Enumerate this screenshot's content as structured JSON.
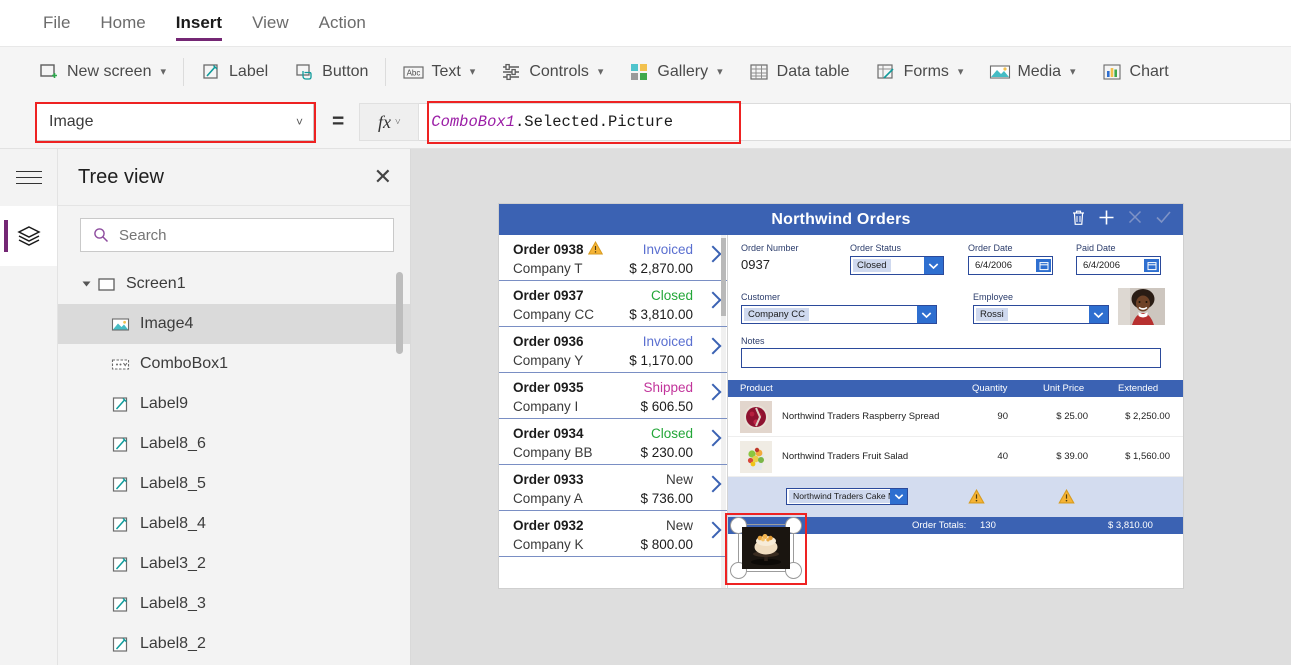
{
  "menu": {
    "items": [
      {
        "label": "File",
        "active": false
      },
      {
        "label": "Home",
        "active": false
      },
      {
        "label": "Insert",
        "active": true
      },
      {
        "label": "View",
        "active": false
      },
      {
        "label": "Action",
        "active": false
      }
    ]
  },
  "ribbon": {
    "items": [
      {
        "label": "New screen",
        "icon": "new-screen-icon",
        "chevron": true
      },
      {
        "label": "Label",
        "icon": "label-icon",
        "chevron": false
      },
      {
        "label": "Button",
        "icon": "button-icon",
        "chevron": false
      },
      {
        "label": "Text",
        "icon": "text-abc-icon",
        "chevron": true
      },
      {
        "label": "Controls",
        "icon": "controls-sliders-icon",
        "chevron": true
      },
      {
        "label": "Gallery",
        "icon": "gallery-icon",
        "chevron": true
      },
      {
        "label": "Data table",
        "icon": "data-table-icon",
        "chevron": false
      },
      {
        "label": "Forms",
        "icon": "forms-icon",
        "chevron": true
      },
      {
        "label": "Media",
        "icon": "media-image-icon",
        "chevron": true
      },
      {
        "label": "Chart",
        "icon": "chart-icon",
        "chevron": false
      }
    ]
  },
  "formula_bar": {
    "property": "Image",
    "equals": "=",
    "fx_label": "fx",
    "expression_ident": "ComboBox1",
    "expression_rest": ".Selected.Picture",
    "highlight_color": "#ee2222"
  },
  "tree_panel": {
    "title": "Tree view",
    "close_icon": "close-icon",
    "search_placeholder": "Search",
    "search_value": "",
    "nodes": [
      {
        "label": "Screen1",
        "icon": "screen-icon",
        "level": 0,
        "selected": false,
        "expanded": true
      },
      {
        "label": "Image4",
        "icon": "image-icon",
        "level": 1,
        "selected": true
      },
      {
        "label": "ComboBox1",
        "icon": "combobox-icon",
        "level": 1,
        "selected": false
      },
      {
        "label": "Label9",
        "icon": "label-icon",
        "level": 1,
        "selected": false
      },
      {
        "label": "Label8_6",
        "icon": "label-icon",
        "level": 1,
        "selected": false
      },
      {
        "label": "Label8_5",
        "icon": "label-icon",
        "level": 1,
        "selected": false
      },
      {
        "label": "Label8_4",
        "icon": "label-icon",
        "level": 1,
        "selected": false
      },
      {
        "label": "Label3_2",
        "icon": "label-icon",
        "level": 1,
        "selected": false
      },
      {
        "label": "Label8_3",
        "icon": "label-icon",
        "level": 1,
        "selected": false
      },
      {
        "label": "Label8_2",
        "icon": "label-icon",
        "level": 1,
        "selected": false
      }
    ]
  },
  "app": {
    "title": "Northwind Orders",
    "header_icons": [
      {
        "name": "delete-icon",
        "enabled": true
      },
      {
        "name": "add-icon",
        "enabled": true
      },
      {
        "name": "cancel-icon",
        "enabled": false
      },
      {
        "name": "save-icon",
        "enabled": false
      }
    ],
    "gallery": [
      {
        "order": "Order 0938",
        "company": "Company T",
        "status": "Invoiced",
        "status_color": "#5a6fd0",
        "amount": "$ 2,870.00",
        "warning": true
      },
      {
        "order": "Order 0937",
        "company": "Company CC",
        "status": "Closed",
        "status_color": "#23a638",
        "amount": "$ 3,810.00",
        "warning": false
      },
      {
        "order": "Order 0936",
        "company": "Company Y",
        "status": "Invoiced",
        "status_color": "#5a6fd0",
        "amount": "$ 1,170.00",
        "warning": false
      },
      {
        "order": "Order 0935",
        "company": "Company I",
        "status": "Shipped",
        "status_color": "#c2349b",
        "amount": "$ 606.50",
        "warning": false
      },
      {
        "order": "Order 0934",
        "company": "Company BB",
        "status": "Closed",
        "status_color": "#23a638",
        "amount": "$ 230.00",
        "warning": false
      },
      {
        "order": "Order 0933",
        "company": "Company A",
        "status": "New",
        "status_color": "#3a3a3a",
        "amount": "$ 736.00",
        "warning": false
      },
      {
        "order": "Order 0932",
        "company": "Company K",
        "status": "New",
        "status_color": "#3a3a3a",
        "amount": "$ 800.00",
        "warning": false
      }
    ],
    "form": {
      "order_number_label": "Order Number",
      "order_number_value": "0937",
      "order_status_label": "Order Status",
      "order_status_value": "Closed",
      "order_date_label": "Order Date",
      "order_date_value": "6/4/2006",
      "paid_date_label": "Paid Date",
      "paid_date_value": "6/4/2006",
      "customer_label": "Customer",
      "customer_value": "Company CC",
      "employee_label": "Employee",
      "employee_value": "Rossi",
      "notes_label": "Notes",
      "notes_value": ""
    },
    "products_table": {
      "columns": [
        "Product",
        "Quantity",
        "Unit Price",
        "Extended"
      ],
      "rows": [
        {
          "product": "Northwind Traders Raspberry Spread",
          "quantity": "90",
          "unit_price": "$ 25.00",
          "extended": "$ 2,250.00",
          "thumb": "raspberry-spread-thumb"
        },
        {
          "product": "Northwind Traders Fruit Salad",
          "quantity": "40",
          "unit_price": "$ 39.00",
          "extended": "$ 1,560.00",
          "thumb": "fruit-salad-thumb"
        }
      ],
      "new_row": {
        "combobox_value": "Northwind Traders Cake Mix",
        "thumb": "cake-mix-thumb",
        "warning_quantity": "warning-icon",
        "warning_price": "warning-icon"
      },
      "totals_label": "Order Totals:",
      "totals_quantity": "130",
      "totals_amount": "$ 3,810.00"
    }
  },
  "colors": {
    "accent_purple": "#742774",
    "app_blue": "#3b62b3",
    "annotation_red": "#ee2222",
    "canvas_bg": "#dedede"
  }
}
